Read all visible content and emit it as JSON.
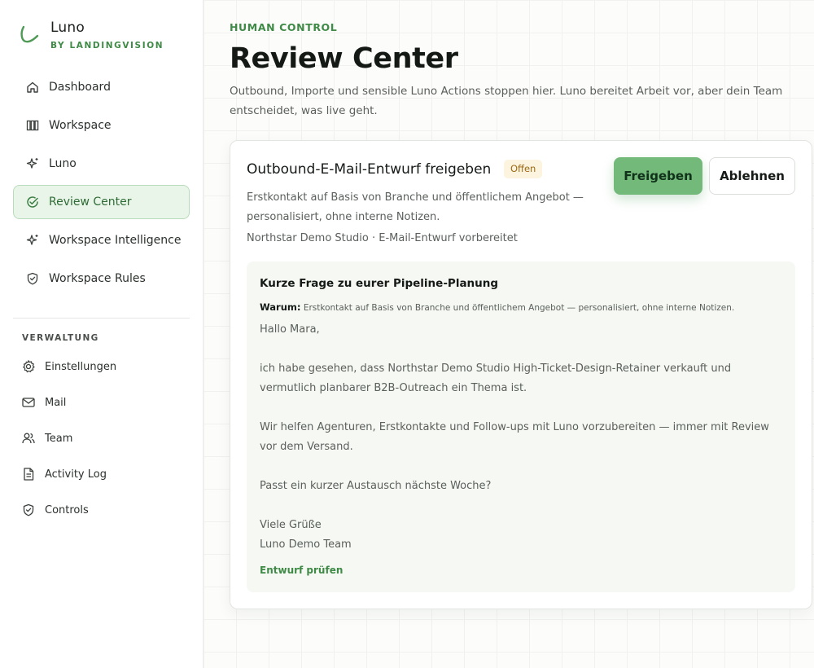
{
  "brand": {
    "name": "Luno",
    "sub": "BY LANDINGVISION",
    "accent": "#3f8a46"
  },
  "sidebar": {
    "items": [
      {
        "label": "Dashboard",
        "icon": "home-icon"
      },
      {
        "label": "Workspace",
        "icon": "columns-icon"
      },
      {
        "label": "Luno",
        "icon": "sparkle-icon"
      },
      {
        "label": "Review Center",
        "icon": "check-circle-icon",
        "active": true
      },
      {
        "label": "Workspace Intelligence",
        "icon": "sparkle-icon"
      },
      {
        "label": "Workspace Rules",
        "icon": "shield-icon"
      }
    ],
    "section_title": "VERWALTUNG",
    "admin_items": [
      {
        "label": "Einstellungen",
        "icon": "gear-icon"
      },
      {
        "label": "Mail",
        "icon": "mail-icon"
      },
      {
        "label": "Team",
        "icon": "users-icon"
      },
      {
        "label": "Activity Log",
        "icon": "document-icon"
      },
      {
        "label": "Controls",
        "icon": "shield-check-icon"
      }
    ]
  },
  "header": {
    "eyebrow": "HUMAN CONTROL",
    "title": "Review Center",
    "description": "Outbound, Importe und sensible Luno Actions stoppen hier. Luno bereitet Arbeit vor, aber dein Team entscheidet, was live geht."
  },
  "review_card": {
    "title": "Outbound-E-Mail-Entwurf freigeben",
    "status": "Offen",
    "approve_label": "Freigeben",
    "reject_label": "Ablehnen",
    "description": "Erstkontakt auf Basis von Branche und öffentlichem Angebot — personalisiert, ohne interne Notizen.",
    "meta": "Northstar Demo Studio · E-Mail-Entwurf vorbereitet",
    "draft": {
      "subject": "Kurze Frage zu eurer Pipeline-Planung",
      "why_label": "Warum:",
      "why_text": "Erstkontakt auf Basis von Branche und öffentlichem Angebot — personalisiert, ohne interne Notizen.",
      "greeting": "Hallo Mara,",
      "paragraph_1": "ich habe gesehen, dass Northstar Demo Studio High-Ticket-Design-Retainer verkauft und vermutlich planbarer B2B-Outreach ein Thema ist.",
      "paragraph_2": "Wir helfen Agenturen, Erstkontakte und Follow-ups mit Luno vorzubereiten — immer mit Review vor dem Versand.",
      "paragraph_3": "Passt ein kurzer Austausch nächste Woche?",
      "closing": "Viele Grüße",
      "signature": "Luno Demo Team",
      "review_link": "Entwurf prüfen"
    }
  }
}
